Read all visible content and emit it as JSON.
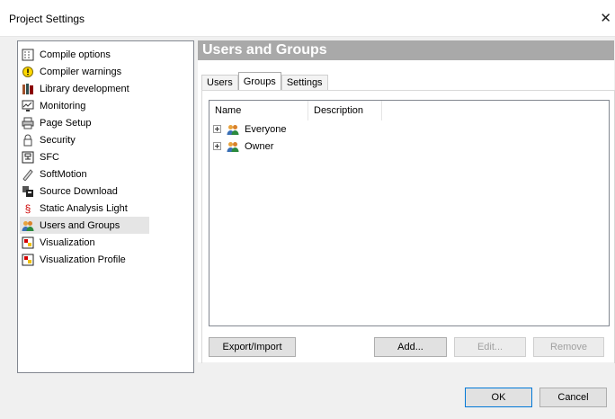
{
  "window": {
    "title": "Project Settings",
    "close_glyph": "✕"
  },
  "sidebar": {
    "items": [
      {
        "label": "Compile options",
        "icon": "compile-options-icon"
      },
      {
        "label": "Compiler warnings",
        "icon": "warning-icon"
      },
      {
        "label": "Library development",
        "icon": "library-icon"
      },
      {
        "label": "Monitoring",
        "icon": "monitoring-icon"
      },
      {
        "label": "Page Setup",
        "icon": "printer-icon"
      },
      {
        "label": "Security",
        "icon": "lock-icon"
      },
      {
        "label": "SFC",
        "icon": "sfc-icon"
      },
      {
        "label": "SoftMotion",
        "icon": "softmotion-icon"
      },
      {
        "label": "Source Download",
        "icon": "source-download-icon"
      },
      {
        "label": "Static Analysis Light",
        "icon": "section-sign-icon"
      },
      {
        "label": "Users and Groups",
        "icon": "users-icon",
        "selected": true
      },
      {
        "label": "Visualization",
        "icon": "visualization-icon"
      },
      {
        "label": "Visualization Profile",
        "icon": "visualization-profile-icon"
      }
    ]
  },
  "main": {
    "header": "Users and Groups",
    "tabs": [
      {
        "label": "Users"
      },
      {
        "label": "Groups",
        "active": true
      },
      {
        "label": "Settings"
      }
    ],
    "tree": {
      "columns": [
        "Name",
        "Description"
      ],
      "rows": [
        {
          "name": "Everyone",
          "description": ""
        },
        {
          "name": "Owner",
          "description": ""
        }
      ]
    },
    "buttons": {
      "export_import": "Export/Import",
      "add": "Add...",
      "edit": "Edit...",
      "remove": "Remove"
    }
  },
  "footer": {
    "ok": "OK",
    "cancel": "Cancel"
  },
  "colors": {
    "header_bg": "#a9a9a9",
    "selected_item": "#e5e5e5",
    "default_button_border": "#0078d7"
  }
}
